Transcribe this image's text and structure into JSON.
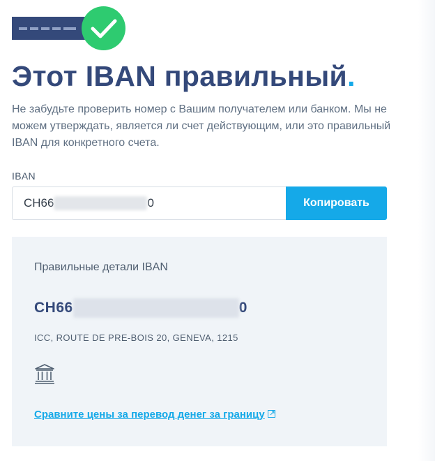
{
  "badge": {
    "icon": "check-icon",
    "tag_color": "#34497a",
    "check_color": "#2ecb70"
  },
  "title": {
    "text": "Этот IBAN правильный",
    "dot": "."
  },
  "description": "Не забудьте проверить номер с Вашим получателем или банком. Мы не можем утверждать, является ли счет действующим, или это правильный IBAN для конкретного счета.",
  "input": {
    "label": "IBAN",
    "value_prefix": "CH66",
    "value_suffix": "0"
  },
  "copy_button": {
    "label": "Копировать"
  },
  "details": {
    "title": "Правильные детали IBAN",
    "iban_prefix": "CH66",
    "iban_suffix": "0",
    "address": "ICC, ROUTE DE PRE-BOIS 20, GENEVA, 1215",
    "bank_icon": "bank-icon",
    "compare_link": "Сравните цены за перевод денег за границу",
    "external_icon": "external-link-icon"
  },
  "colors": {
    "primary": "#34497a",
    "accent": "#15a9e8",
    "success": "#2ecb70",
    "card_bg": "#f0f4f8"
  }
}
